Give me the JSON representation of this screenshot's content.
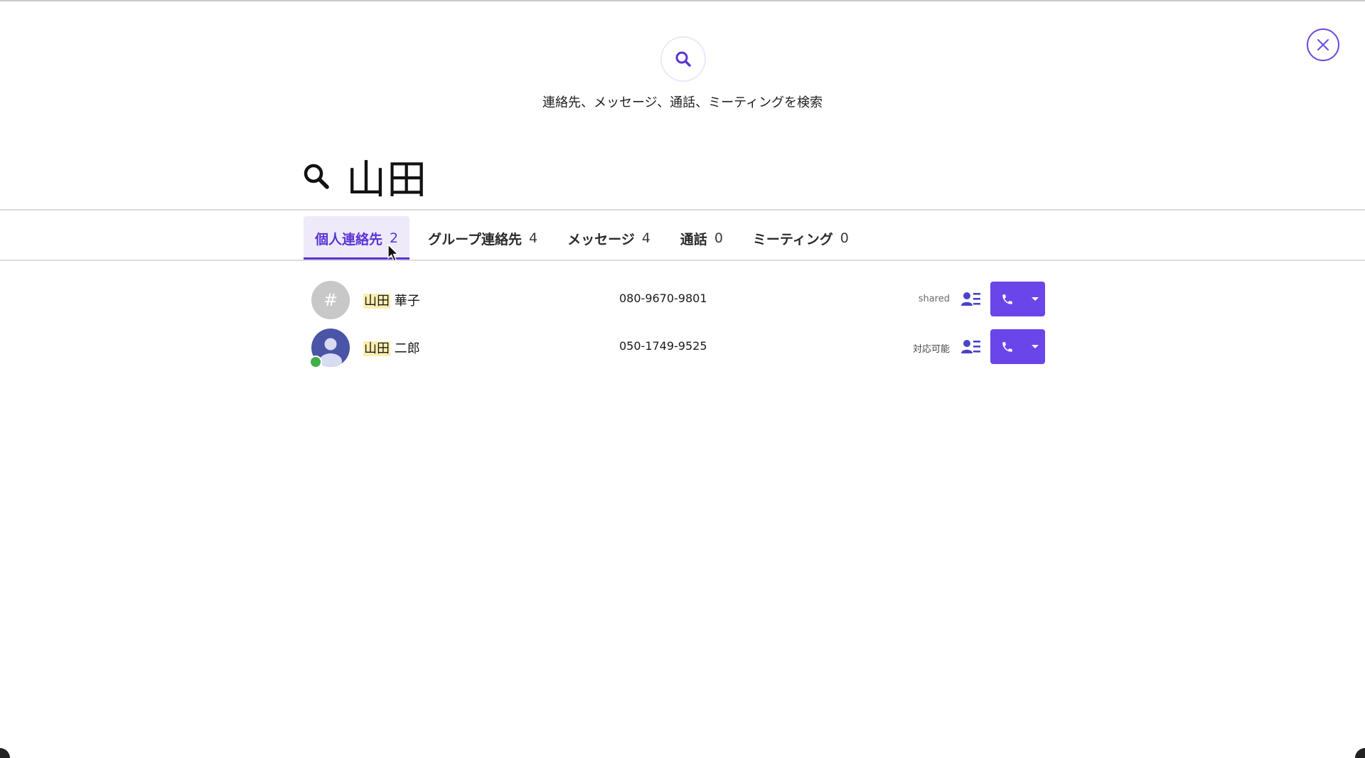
{
  "header": {
    "subtitle": "連絡先、メッセージ、通話、ミーティングを検索",
    "icons": {
      "search_badge": "search-icon",
      "close": "close-icon"
    }
  },
  "search": {
    "query": "山田"
  },
  "tabs": [
    {
      "label": "個人連絡先",
      "count": "2",
      "active": true
    },
    {
      "label": "グループ連絡先",
      "count": "4",
      "active": false
    },
    {
      "label": "メッセージ",
      "count": "4",
      "active": false
    },
    {
      "label": "通話",
      "count": "0",
      "active": false
    },
    {
      "label": "ミーティング",
      "count": "0",
      "active": false
    }
  ],
  "results": [
    {
      "avatar": "#",
      "name_highlight": "山田",
      "name_rest": "華子",
      "phone": "080-9670-9801",
      "status": "shared",
      "presence": null
    },
    {
      "avatar": "person-icon",
      "name_highlight": "山田",
      "name_rest": "二郎",
      "phone": "050-1749-9525",
      "status": "対応可能",
      "presence": "online"
    }
  ],
  "colors": {
    "accent": "#6a45ea",
    "tab_active": "#5b33d6",
    "tab_active_bg": "#eeeaf9",
    "highlight": "#fdeeb0",
    "online": "#3fae49"
  }
}
